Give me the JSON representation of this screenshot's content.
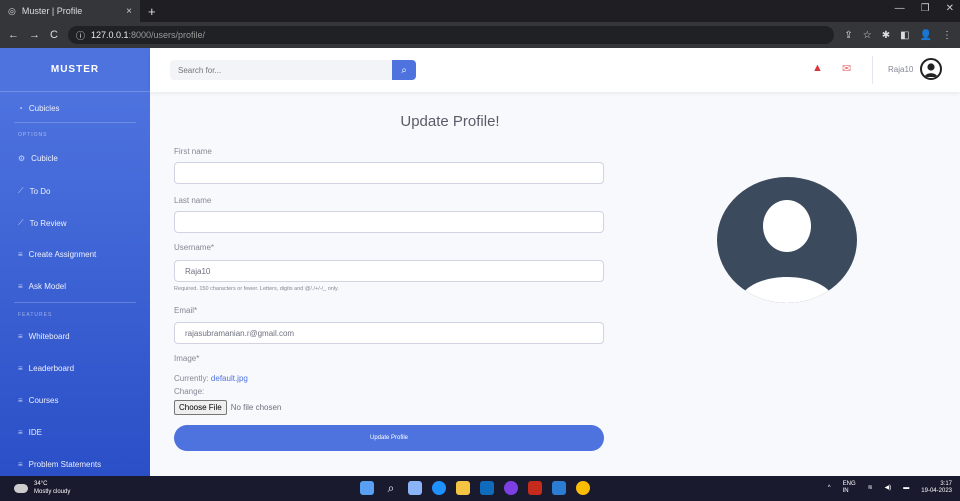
{
  "browser": {
    "tab_title": "Muster | Profile",
    "url_host": "127.0.0.1",
    "url_path": ":8000/users/profile/"
  },
  "sidebar": {
    "brand": "MUSTER",
    "items": [
      {
        "label": "Cubicles",
        "icon": "dashboard-icon"
      },
      {
        "label": "Cubicle",
        "icon": "gear-icon"
      },
      {
        "label": "To Do",
        "icon": "wrench-icon"
      },
      {
        "label": "To Review",
        "icon": "wrench-icon"
      },
      {
        "label": "Create Assignment",
        "icon": "list-icon"
      },
      {
        "label": "Ask Model",
        "icon": "list-icon"
      },
      {
        "label": "Whiteboard",
        "icon": "list-icon"
      },
      {
        "label": "Leaderboard",
        "icon": "list-icon"
      },
      {
        "label": "Courses",
        "icon": "list-icon"
      },
      {
        "label": "IDE",
        "icon": "list-icon"
      },
      {
        "label": "Problem Statements",
        "icon": "list-icon"
      }
    ],
    "headings": [
      "Options",
      "Features"
    ]
  },
  "topbar": {
    "search_placeholder": "Search for...",
    "bell_badge": "",
    "mail_badge": "",
    "username": "Raja10"
  },
  "form": {
    "title": "Update Profile!",
    "first_name_label": "First name",
    "first_name_value": "",
    "last_name_label": "Last name",
    "last_name_value": "",
    "username_label": "Username*",
    "username_value": "Raja10",
    "username_help": "Required. 150 characters or fewer. Letters, digits and @/./+/-/_ only.",
    "email_label": "Email*",
    "email_value": "rajasubramanian.r@gmail.com",
    "image_label": "Image*",
    "currently_label": "Currently:",
    "currently_value": "default.jpg",
    "change_label": "Change:",
    "choose_file": "Choose File",
    "no_file": "No file chosen",
    "submit": "Update Profile"
  },
  "taskbar": {
    "weather_temp": "34°C",
    "weather_desc": "Mostly cloudy",
    "lang": "ENG",
    "region": "IN",
    "time": "3:17",
    "date": "19-04-2023"
  },
  "colors": {
    "primary": "#4e73df",
    "sidebar_dark": "#2a4fc7",
    "avatar": "#3b4a5c"
  }
}
